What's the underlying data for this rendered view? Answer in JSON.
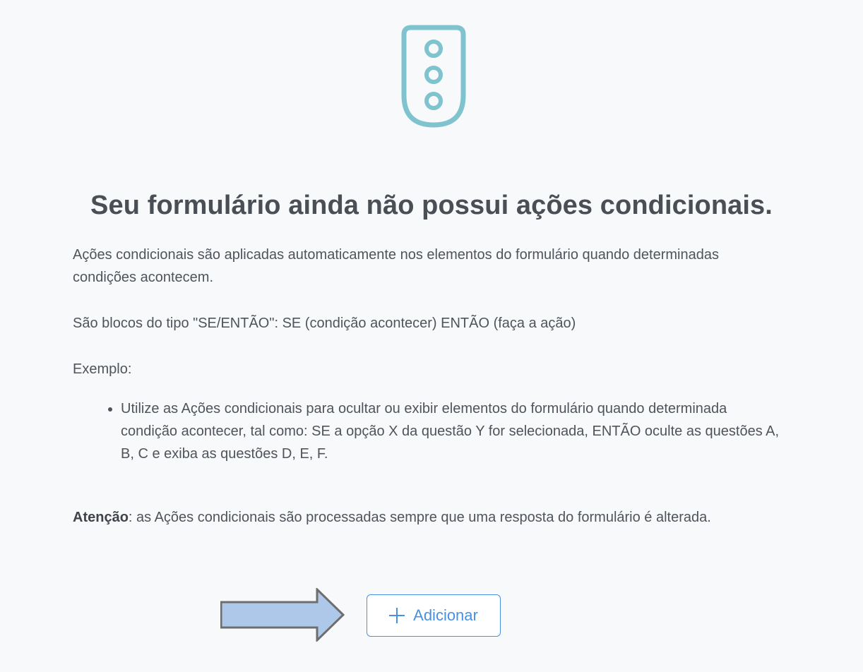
{
  "empty_state": {
    "icon": "traffic-light-icon",
    "icon_color": "#7fc3cf",
    "title": "Seu formulário ainda não possui ações condicionais.",
    "paragraph1": "Ações condicionais são aplicadas automaticamente nos elementos do formulário quando determinadas condições acontecem.",
    "paragraph2": "São blocos do tipo \"SE/ENTÃO\": SE (condição acontecer) ENTÃO (faça a ação)",
    "example_label": "Exemplo:",
    "example_items": [
      "Utilize as Ações condicionais para ocultar ou exibir elementos do formulário quando determinada condição acontecer, tal como: SE a opção X da questão Y for selecionada, ENTÃO oculte as questões A, B, C e exiba as questões D, E, F."
    ],
    "attention_label": "Atenção",
    "attention_text": ": as Ações condicionais são processadas sempre que uma resposta do formulário é alterada."
  },
  "actions": {
    "add_label": "Adicionar",
    "add_icon": "plus-icon",
    "accent_color": "#4a90e2"
  },
  "annotation": {
    "arrow_icon": "arrow-right-icon",
    "arrow_fill": "#adc8e8",
    "arrow_stroke": "#6e6e6e"
  }
}
